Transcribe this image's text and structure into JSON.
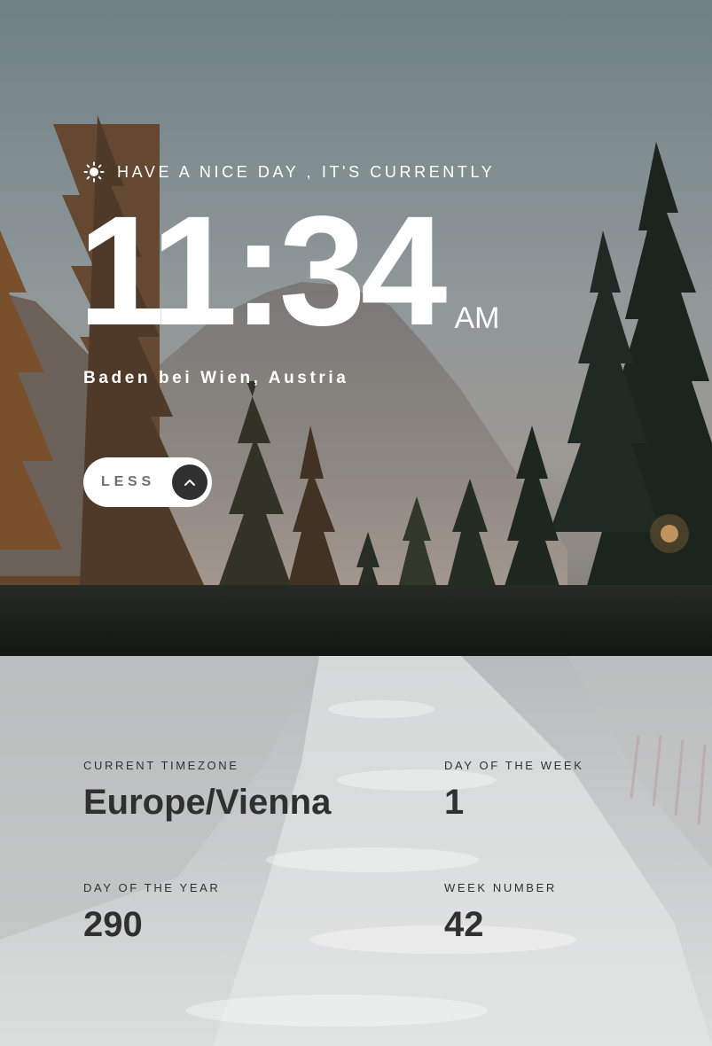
{
  "greeting": {
    "icon": "sun-icon",
    "text": "HAVE A NICE DAY , IT'S CURRENTLY"
  },
  "clock": {
    "time": "11:34",
    "period": "AM"
  },
  "location": "Baden bei Wien, Austria",
  "toggle": {
    "label": "LESS",
    "icon": "chevron-up-icon"
  },
  "details": {
    "timezone": {
      "label": "CURRENT TIMEZONE",
      "value": "Europe/Vienna"
    },
    "day_of_week": {
      "label": "DAY OF THE WEEK",
      "value": "1"
    },
    "day_of_year": {
      "label": "DAY OF THE YEAR",
      "value": "290"
    },
    "week_number": {
      "label": "WEEK NUMBER",
      "value": "42"
    }
  },
  "colors": {
    "text_light": "#ffffff",
    "text_dark": "#303030",
    "button_bg": "#ffffff",
    "button_icon_bg": "#303030",
    "panel_bg": "#d6d7d8"
  }
}
